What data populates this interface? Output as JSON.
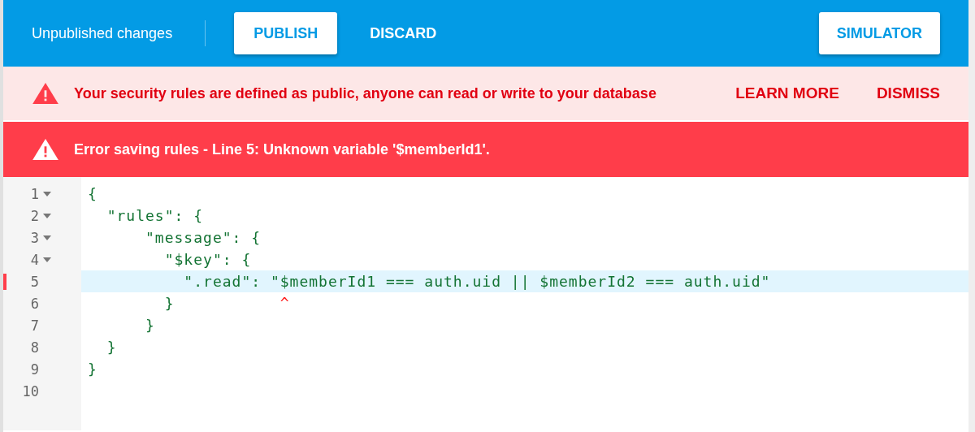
{
  "toolbar": {
    "status": "Unpublished changes",
    "buttons": [
      {
        "label": "PUBLISH",
        "kind": "raised"
      },
      {
        "label": "DISCARD",
        "kind": "flat"
      }
    ],
    "simulator": {
      "label": "SIMULATOR"
    }
  },
  "warning": {
    "message": "Your security rules are defined as public, anyone can read or write to your database",
    "actions": [
      "LEARN MORE",
      "DISMISS"
    ]
  },
  "error": {
    "message": "Error saving rules - Line 5: Unknown variable '$memberId1'."
  },
  "editor": {
    "lines": [
      {
        "number": "1",
        "text": "{",
        "foldable": true,
        "error": false
      },
      {
        "number": "2",
        "text": "  \"rules\": {",
        "foldable": true,
        "error": false
      },
      {
        "number": "3",
        "text": "      \"message\": {",
        "foldable": true,
        "error": false
      },
      {
        "number": "4",
        "text": "        \"$key\": {",
        "foldable": true,
        "error": false
      },
      {
        "number": "5",
        "text": "          \".read\": \"$memberId1 === auth.uid || $memberId2 === auth.uid\"",
        "foldable": false,
        "error": true
      },
      {
        "number": "6",
        "text": "        }",
        "foldable": false,
        "error": false,
        "caret": "           ^"
      },
      {
        "number": "7",
        "text": "      }",
        "foldable": false,
        "error": false
      },
      {
        "number": "8",
        "text": "  }",
        "foldable": false,
        "error": false
      },
      {
        "number": "9",
        "text": "}",
        "foldable": false,
        "error": false
      },
      {
        "number": "10",
        "foldable": false,
        "error": false
      }
    ]
  }
}
